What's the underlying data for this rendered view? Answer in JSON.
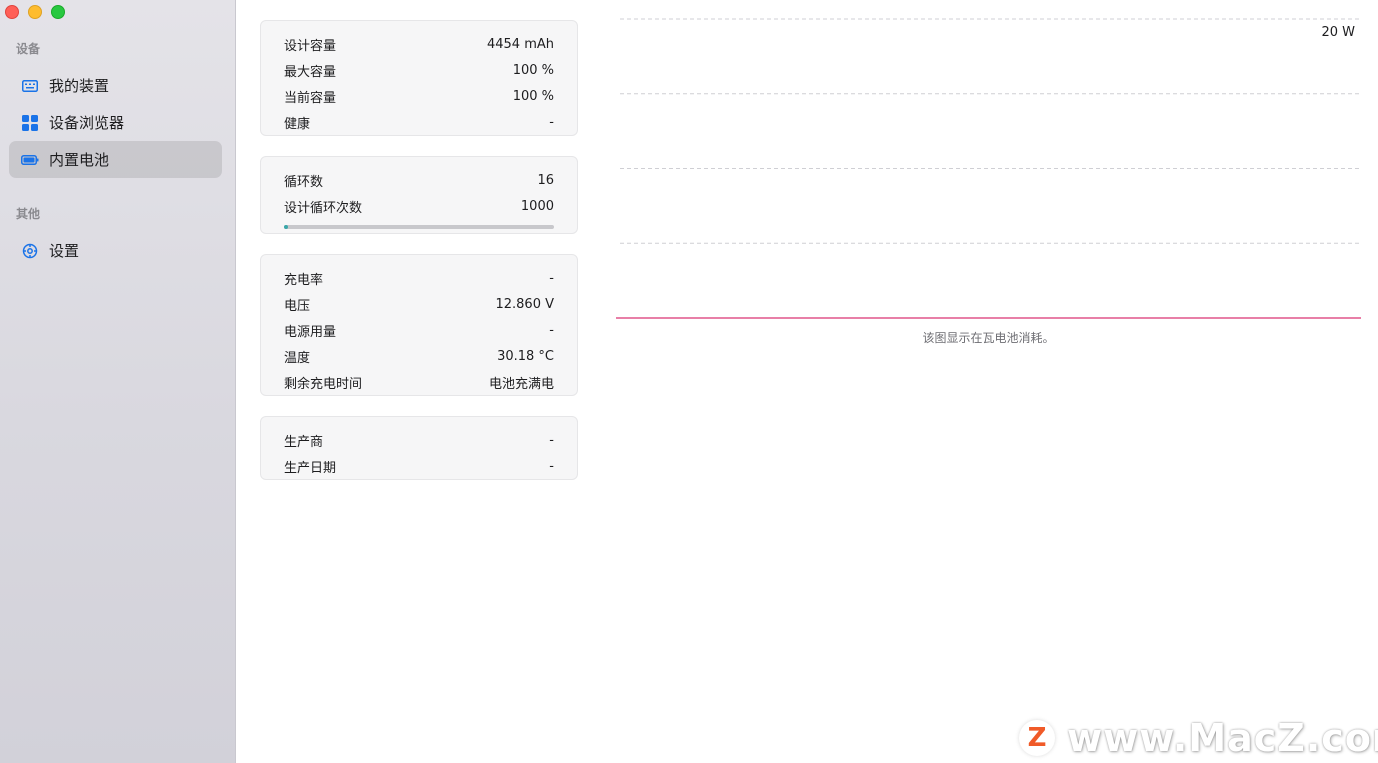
{
  "sidebar": {
    "section_devices": "设备",
    "items": [
      {
        "label": "我的装置",
        "icon": "keyboard-icon"
      },
      {
        "label": "设备浏览器",
        "icon": "grid-icon"
      },
      {
        "label": "内置电池",
        "icon": "battery-icon",
        "selected": true
      }
    ],
    "section_other": "其他",
    "other_items": [
      {
        "label": "设置",
        "icon": "gear-icon"
      }
    ]
  },
  "capacity_card": {
    "rows": [
      {
        "label": "设计容量",
        "value": "4454 mAh"
      },
      {
        "label": "最大容量",
        "value": "100 %"
      },
      {
        "label": "当前容量",
        "value": "100 %"
      },
      {
        "label": "健康",
        "value": "-"
      }
    ]
  },
  "cycle_card": {
    "rows": [
      {
        "label": "循环数",
        "value": "16"
      },
      {
        "label": "设计循环次数",
        "value": "1000"
      }
    ],
    "progress": 0.016
  },
  "power_card": {
    "rows": [
      {
        "label": "充电率",
        "value": "-"
      },
      {
        "label": "电压",
        "value": "12.860 V"
      },
      {
        "label": "电源用量",
        "value": "-"
      },
      {
        "label": "温度",
        "value": "30.18 °C"
      },
      {
        "label": "剩余充电时间",
        "value": "电池充满电"
      }
    ]
  },
  "maker_card": {
    "rows": [
      {
        "label": "生产商",
        "value": "-"
      },
      {
        "label": "生产日期",
        "value": "-"
      }
    ]
  },
  "chart": {
    "y_max_label": "20 W",
    "caption": "该图显示在瓦电池消耗。",
    "line_color": "#e0558a"
  },
  "chart_data": {
    "type": "line",
    "title": "",
    "xlabel": "",
    "ylabel": "",
    "ylim": [
      0,
      20
    ],
    "grid": true,
    "series": [
      {
        "values": [
          0,
          0
        ]
      }
    ]
  },
  "watermark": {
    "logo": "Z",
    "text": "www.MacZ.com"
  },
  "colors": {
    "accent": "#1a73e8",
    "progress": "#3aa7a9"
  }
}
